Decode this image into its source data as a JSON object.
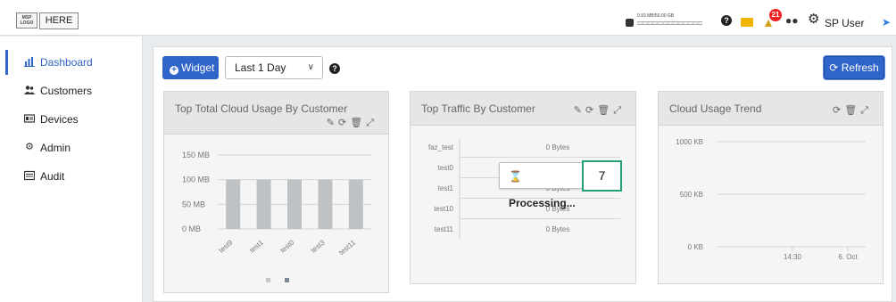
{
  "header": {
    "logo_text": "MSP LOGO",
    "here_label": "HERE",
    "storage_text": "0.93 MB/50.00 GB",
    "storage_used_fraction": 0.0,
    "alert_count": "21",
    "user_name": "SP User"
  },
  "sidebar": {
    "items": [
      {
        "label": "Dashboard",
        "icon": "bar-chart-icon",
        "active": true
      },
      {
        "label": "Customers",
        "icon": "users-icon"
      },
      {
        "label": "Devices",
        "icon": "device-icon"
      },
      {
        "label": "Admin",
        "icon": "cogs-icon"
      },
      {
        "label": "Audit",
        "icon": "list-icon"
      }
    ]
  },
  "toolbar": {
    "widget_label": "Widget",
    "range_value": "Last 1 Day",
    "refresh_label": "Refresh"
  },
  "widgets": {
    "cloud_usage": {
      "title": "Top Total Cloud Usage By Customer",
      "y_ticks": [
        "150 MB",
        "100 MB",
        "50 MB",
        "0 MB"
      ],
      "pagination_dots": 2
    },
    "traffic": {
      "title": "Top Traffic By Customer"
    },
    "trend": {
      "title": "Cloud Usage Trend",
      "y_ticks": [
        "1000 KB",
        "500 KB",
        "0 KB"
      ],
      "x_ticks": [
        "14:30",
        "6. Oct"
      ]
    }
  },
  "overlay": {
    "processing_label": "Processing...",
    "marker_number": "7"
  },
  "chart_data": [
    {
      "type": "bar",
      "title": "Top Total Cloud Usage By Customer",
      "categories": [
        "test9",
        "test1",
        "test0",
        "test3",
        "test11"
      ],
      "values": [
        100,
        100,
        100,
        100,
        100
      ],
      "ylabel": "",
      "ylim": [
        0,
        150
      ],
      "y_unit": "MB",
      "grid": true,
      "color": "#bfc2c5"
    },
    {
      "type": "bar",
      "title": "Top Traffic By Customer",
      "categories": [
        "faz_test",
        "test0",
        "test1",
        "test10",
        "test11"
      ],
      "value_labels": [
        "0 Bytes",
        "0 Bytes",
        "0 Bytes",
        "0 Bytes",
        "0 Bytes"
      ],
      "values": [
        0,
        0,
        0,
        0,
        0
      ],
      "orientation": "horizontal"
    },
    {
      "type": "line",
      "title": "Cloud Usage Trend",
      "x_ticks": [
        "14:30",
        "6. Oct"
      ],
      "ylim": [
        0,
        1000
      ],
      "y_unit": "KB",
      "y_ticks": [
        0,
        500,
        1000
      ],
      "series": []
    }
  ]
}
